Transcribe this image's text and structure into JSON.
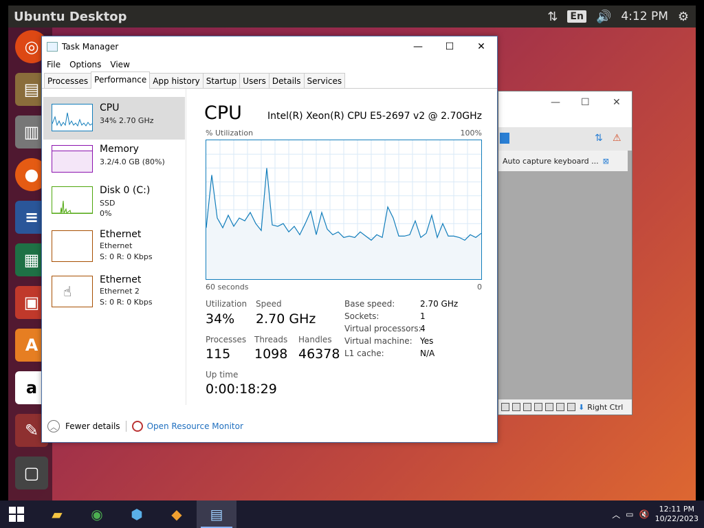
{
  "desktop": {
    "title": "Ubuntu Desktop",
    "language": "En",
    "time": "4:12 PM"
  },
  "vbox": {
    "notification": "Auto capture keyboard ...",
    "host_key": "Right Ctrl"
  },
  "task_manager": {
    "title": "Task Manager",
    "menu": [
      "File",
      "Options",
      "View"
    ],
    "tabs": [
      "Processes",
      "Performance",
      "App history",
      "Startup",
      "Users",
      "Details",
      "Services"
    ],
    "active_tab": "Performance",
    "side_items": [
      {
        "name": "CPU",
        "sub1": "34% 2.70 GHz",
        "sub2": ""
      },
      {
        "name": "Memory",
        "sub1": "3.2/4.0 GB (80%)",
        "sub2": ""
      },
      {
        "name": "Disk 0 (C:)",
        "sub1": "SSD",
        "sub2": "0%"
      },
      {
        "name": "Ethernet",
        "sub1": "Ethernet",
        "sub2": "S: 0 R: 0 Kbps"
      },
      {
        "name": "Ethernet",
        "sub1": "Ethernet 2",
        "sub2": "S: 0 R: 0 Kbps"
      }
    ],
    "cpu": {
      "heading": "CPU",
      "model": "Intel(R) Xeon(R) CPU E5-2697 v2 @ 2.70GHz",
      "util_label": "% Utilization",
      "max_label": "100%",
      "time_label": "60 seconds",
      "zero_label": "0",
      "utilization_label": "Utilization",
      "utilization": "34%",
      "speed_label": "Speed",
      "speed": "2.70 GHz",
      "processes_label": "Processes",
      "processes": "115",
      "threads_label": "Threads",
      "threads": "1098",
      "handles_label": "Handles",
      "handles": "46378",
      "uptime_label": "Up time",
      "uptime": "0:00:18:29",
      "details": [
        {
          "k": "Base speed:",
          "v": "2.70 GHz"
        },
        {
          "k": "Sockets:",
          "v": "1"
        },
        {
          "k": "Virtual processors:",
          "v": "4"
        },
        {
          "k": "Virtual machine:",
          "v": "Yes"
        },
        {
          "k": "L1 cache:",
          "v": "N/A"
        }
      ],
      "history": [
        37,
        75,
        44,
        37,
        46,
        38,
        44,
        42,
        48,
        40,
        35,
        80,
        39,
        38,
        40,
        34,
        38,
        32,
        40,
        49,
        32,
        48,
        36,
        32,
        34,
        30,
        31,
        30,
        34,
        31,
        28,
        32,
        30,
        52,
        44,
        31,
        31,
        32,
        42,
        30,
        33,
        46,
        30,
        40,
        31,
        31,
        30,
        28,
        32,
        30,
        33
      ]
    },
    "bottom": {
      "fewer": "Fewer details",
      "monitor": "Open Resource Monitor"
    }
  },
  "taskbar": {
    "time": "12:11 PM",
    "date": "10/22/2023"
  }
}
